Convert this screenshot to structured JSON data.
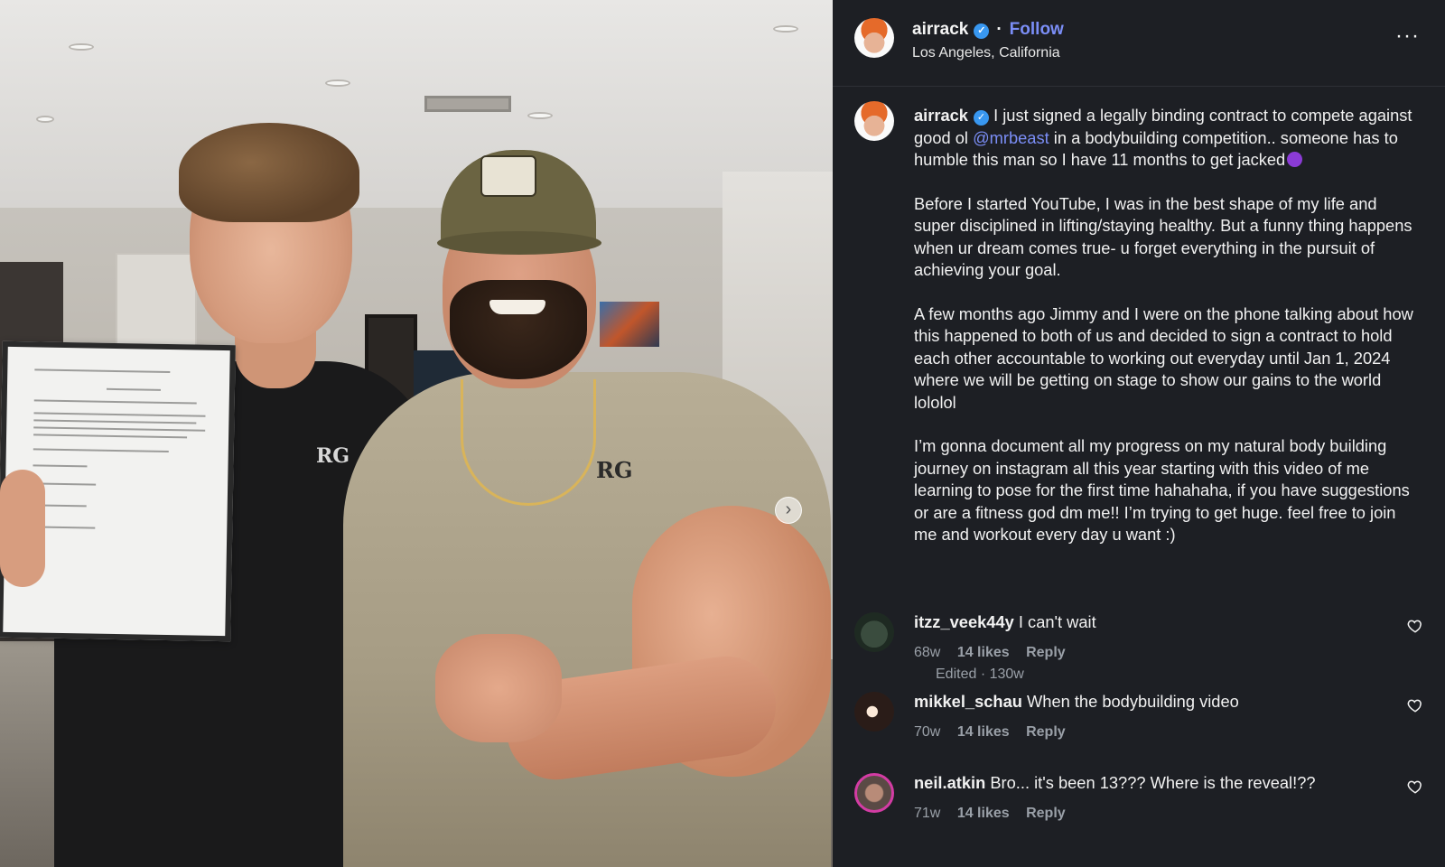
{
  "header": {
    "username": "airrack",
    "separator": "·",
    "follow_label": "Follow",
    "location": "Los Angeles, California",
    "more_label": "···"
  },
  "caption": {
    "username": "airrack",
    "line_1_a": "I just signed a legally binding contract to compete against good ol",
    "mention": "@mrbeast",
    "line_1_b": "in a bodybuilding competition.. someone has to humble this man so I have 11 months to get jacked",
    "para_2": "Before I started YouTube, I was in the best shape of my life and super disciplined in lifting/staying healthy. But a funny thing happens when ur dream comes true- u forget everything in the pursuit of achieving your goal.",
    "para_3": "A few months ago Jimmy and I were on the phone talking about how this happened to both of us and decided to sign a contract to hold each other accountable to working out everyday until Jan 1, 2024 where we will be getting on stage to show our gains to the world lololol",
    "para_4": "I’m gonna document all my progress on my natural body building journey on instagram all this year starting with this video of me learning to pose for the first time hahahaha, if you have suggestions or are a fitness god dm me!! I’m trying to get huge. feel free to join me and workout every day u want :)",
    "edited": "Edited · 130w"
  },
  "comments": [
    {
      "username": "itzz_veek44y",
      "text": "I can't wait",
      "age": "68w",
      "likes": "14 likes",
      "reply": "Reply"
    },
    {
      "username": "mikkel_schau",
      "text": "When the bodybuilding video",
      "age": "70w",
      "likes": "14 likes",
      "reply": "Reply"
    },
    {
      "username": "neil.atkin",
      "text": "Bro... it's been 13??? Where is the reveal!??",
      "age": "71w",
      "likes": "14 likes",
      "reply": "Reply"
    }
  ],
  "photo": {
    "shirt_logo_1": "RG",
    "shirt_logo_2": "RG",
    "next_icon": "›"
  },
  "colors": {
    "sidebar_bg": "#1d1f24",
    "link": "#7b8ef7",
    "verified": "#3897f0",
    "muted": "#9aa0a8"
  },
  "icons": [
    "verified-badge-icon",
    "more-options-icon",
    "heart-icon",
    "chevron-right-icon",
    "devil-emoji-icon"
  ]
}
